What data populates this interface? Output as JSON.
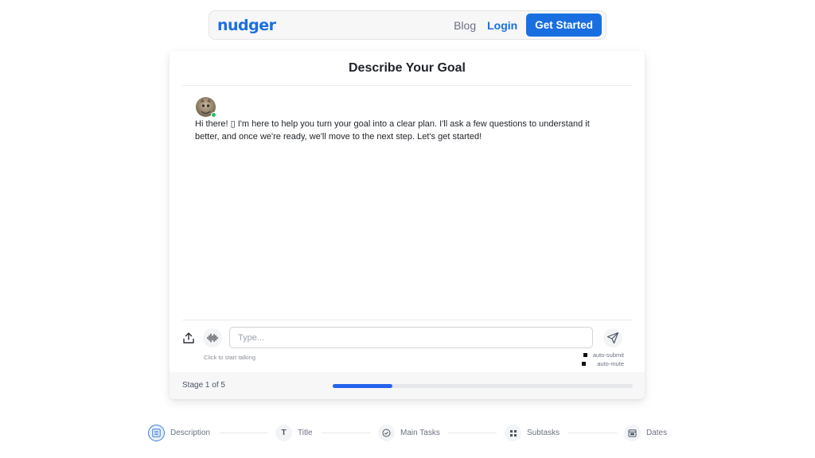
{
  "nav": {
    "logo": "nudger",
    "blog": "Blog",
    "login": "Login",
    "get_started": "Get Started"
  },
  "card": {
    "title": "Describe Your Goal",
    "message": "Hi there! ▯ I'm here to help you turn your goal into a clear plan. I'll ask a few questions to understand it better, and once we're ready, we'll move to the next step. Let's get started!"
  },
  "input": {
    "placeholder": "Type...",
    "value": "",
    "hint": "Click to start talking",
    "auto_submit": "auto-submit",
    "auto_mute": "auto-mute"
  },
  "stage": {
    "label": "Stage 1 of 5",
    "current": 1,
    "total": 5,
    "progress_fraction": 0.2
  },
  "steps": [
    {
      "label": "Description",
      "icon": "list-icon",
      "active": true
    },
    {
      "label": "Title",
      "icon": "text-icon",
      "active": false
    },
    {
      "label": "Main Tasks",
      "icon": "check-circle-icon",
      "active": false
    },
    {
      "label": "Subtasks",
      "icon": "grid-icon",
      "active": false
    },
    {
      "label": "Dates",
      "icon": "calendar-icon",
      "active": false
    }
  ],
  "colors": {
    "accent": "#1a6fe0",
    "progress": "#2563eb",
    "online": "#22c55e"
  }
}
